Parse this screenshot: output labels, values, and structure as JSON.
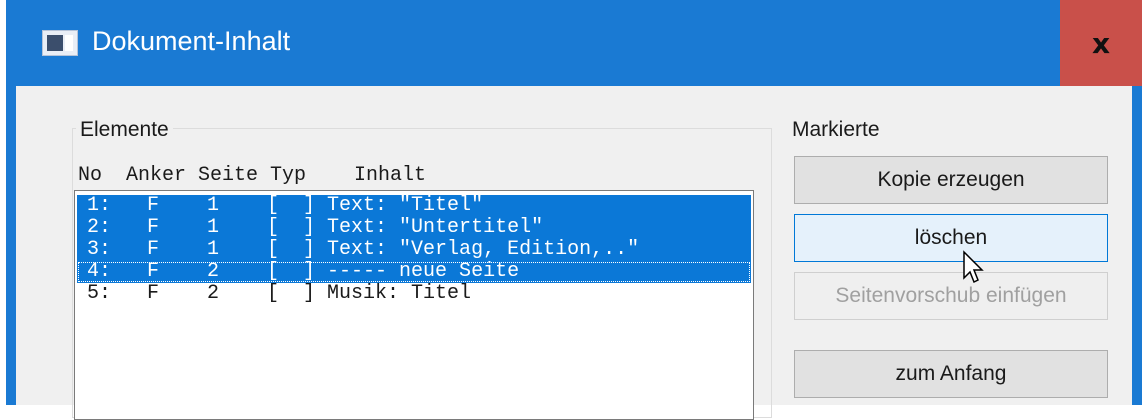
{
  "window": {
    "title": "Dokument-Inhalt",
    "close_label": "x"
  },
  "elements_group": {
    "label": "Elemente",
    "header": "No  Anker Seite Typ    Inhalt",
    "rows": [
      {
        "text": "1:   F    1    [  ] Text: \"Titel\"",
        "selected": true
      },
      {
        "text": "2:   F    1    [  ] Text: \"Untertitel\"",
        "selected": true
      },
      {
        "text": "3:   F    1    [  ] Text: \"Verlag, Edition,..\"",
        "selected": true
      },
      {
        "text": "4:   F    2    [  ] ----- neue Seite",
        "selected": true
      },
      {
        "text": "5:   F    2    [  ] Musik: Titel",
        "selected": false
      }
    ]
  },
  "markierte": {
    "label": "Markierte",
    "buttons": {
      "copy": "Kopie erzeugen",
      "delete": "löschen",
      "pagebreak": "Seitenvorschub einfügen",
      "to_start": "zum Anfang"
    }
  },
  "colors": {
    "titlebar": "#1a7ad3",
    "close": "#c9504a",
    "selection": "#0b78d7"
  }
}
